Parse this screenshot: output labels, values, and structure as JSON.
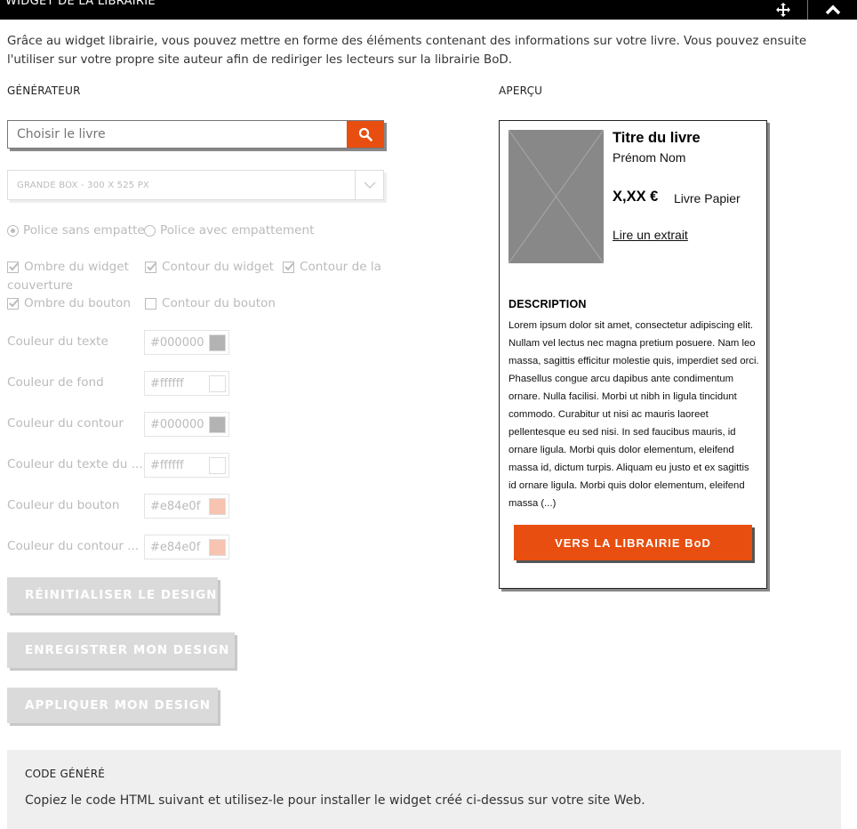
{
  "header": {
    "title": "WIDGET DE LA LIBRAIRIE",
    "move_icon": "move-arrows-icon",
    "close_icon": "chevron-up-icon"
  },
  "intro": "Grâce au widget librairie, vous pouvez mettre en forme des éléments contenant des informations sur votre livre. Vous pouvez ensuite l'utiliser sur votre propre site auteur afin de rediriger les lecteurs sur la librairie BoD.",
  "generator": {
    "heading": "GÉNÉRATEUR",
    "search_placeholder": "Choisir le livre",
    "search_icon": "search-icon",
    "size_select": "GRANDE BOX - 300 X 525 PX",
    "font_options": [
      {
        "label": "Police sans empatte",
        "selected": true
      },
      {
        "label": "Police avec empattement",
        "selected": false
      }
    ],
    "checkboxes": [
      {
        "label": "Ombre du widget",
        "checked": true
      },
      {
        "label": "Contour du widget",
        "checked": true
      },
      {
        "label": "Contour de la",
        "checked": true
      },
      {
        "label": "couverture",
        "checked": true
      },
      {
        "label": "Ombre du bouton",
        "checked": true
      },
      {
        "label": "Contour du bouton",
        "checked": false
      }
    ],
    "colors": [
      {
        "label": "Couleur du texte",
        "value": "#000000",
        "swatch": "#b3b3b3"
      },
      {
        "label": "Couleur de fond",
        "value": "#ffffff",
        "swatch": "#ffffff"
      },
      {
        "label": "Couleur du contour",
        "value": "#000000",
        "swatch": "#b3b3b3"
      },
      {
        "label": "Couleur du texte du ...",
        "value": "#ffffff",
        "swatch": "#ffffff"
      },
      {
        "label": "Couleur du bouton",
        "value": "#e84e0f",
        "swatch": "#f6c4b0"
      },
      {
        "label": "Couleur du contour ...",
        "value": "#e84e0f",
        "swatch": "#f6c4b0"
      }
    ],
    "buttons": {
      "reset": "RÉINITIALISER LE DESIGN",
      "save": "ENREGISTRER MON DESIGN",
      "apply": "APPLIQUER MON DESIGN"
    }
  },
  "preview": {
    "heading": "APERÇU",
    "title": "Titre du livre",
    "author": "Prénom Nom",
    "price": "X,XX  €",
    "format": "Livre Papier",
    "extract_link": "Lire un extrait",
    "description_heading": "DESCRIPTION",
    "description": "Lorem ipsum dolor sit amet, consectetur adipiscing elit. Nullam vel lectus nec magna pretium posuere. Nam leo massa, sagittis efficitur molestie quis, imperdiet sed orci. Phasellus congue arcu dapibus ante condimentum ornare. Nulla facilisi. Morbi ut nibh in ligula tincidunt commodo. Curabitur ut nisi ac mauris laoreet pellentesque eu sed nisi. In sed faucibus mauris, id ornare ligula. Morbi quis dolor elementum, eleifend massa id, dictum turpis. Aliquam eu justo et ex sagittis id ornare ligula. Morbi quis dolor elementum, eleifend massa (...)",
    "cta": "VERS LA LIBRAIRIE BoD"
  },
  "code_section": {
    "heading": "CODE GÉNÉRÉ",
    "description": "Copiez le code HTML suivant et utilisez-le pour installer le widget créé ci-dessus sur votre site Web."
  },
  "colors": {
    "accent": "#e84e0f",
    "disabled_text": "#bbbbbb",
    "disabled_button": "#dadada"
  }
}
